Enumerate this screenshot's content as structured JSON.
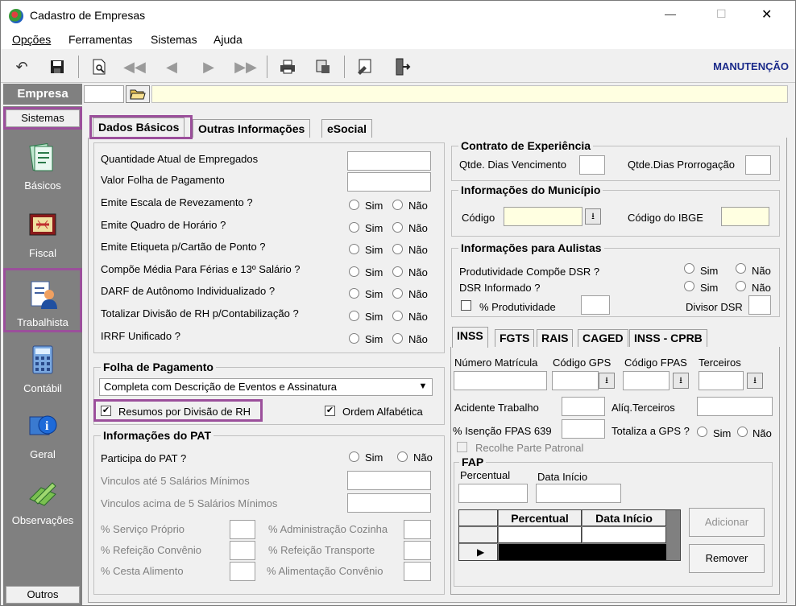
{
  "window": {
    "title": "Cadastro de Empresas",
    "minimize": "—",
    "maximize": "☐",
    "close": "✕"
  },
  "menu": [
    "Opções",
    "Ferramentas",
    "Sistemas",
    "Ajuda"
  ],
  "toolbar": {
    "mode": "MANUTENÇÃO"
  },
  "empresa": {
    "label": "Empresa",
    "value": ""
  },
  "nav": {
    "header": "Sistemas",
    "items": [
      "Básicos",
      "Fiscal",
      "Trabalhista",
      "Contábil",
      "Geral",
      "Observações"
    ],
    "footer": "Outros"
  },
  "tabs": [
    "Dados Básicos",
    "Outras Informações",
    "eSocial"
  ],
  "radio": {
    "sim": "Sim",
    "nao": "Não"
  },
  "basic": {
    "qtd_empregados": "Quantidade Atual de Empregados",
    "valor_folha": "Valor Folha de Pagamento",
    "questions": [
      "Emite Escala de Revezamento ?",
      "Emite Quadro de Horário ?",
      "Emite Etiqueta p/Cartão de Ponto ?",
      "Compõe Média Para Férias e 13º Salário ?",
      "DARF de Autônomo Individualizado ?",
      "Totalizar Divisão de RH p/Contabilização ?",
      "IRRF Unificado ?"
    ]
  },
  "folha": {
    "title": "Folha de Pagamento",
    "select": "Completa com Descrição de Eventos e Assinatura",
    "resumos": "Resumos por Divisão de RH",
    "ordem": "Ordem Alfabética"
  },
  "pat": {
    "title": "Informações do PAT",
    "participa": "Participa do PAT ?",
    "ate5": "Vinculos até 5 Salários Mínimos",
    "acima5": "Vinculos acima de 5 Salários Mínimos",
    "left": [
      "% Serviço Próprio",
      "% Refeição Convênio",
      "% Cesta Alimento"
    ],
    "right": [
      "% Administração Cozinha",
      "% Refeição Transporte",
      "% Alimentação Convênio"
    ]
  },
  "contrato": {
    "title": "Contrato de Experiência",
    "venc": "Qtde. Dias Vencimento",
    "prorr": "Qtde.Dias Prorrogação"
  },
  "municipio": {
    "title": "Informações do Município",
    "codigo": "Código",
    "ibge": "Código do IBGE"
  },
  "aulistas": {
    "title": "Informações para Aulistas",
    "prod": "Produtividade Compõe DSR ?",
    "dsr": "DSR Informado ?",
    "pct": "% Produtividade",
    "divisor": "Divisor DSR"
  },
  "inner_tabs": [
    "INSS",
    "FGTS",
    "RAIS",
    "CAGED",
    "INSS - CPRB"
  ],
  "inss": {
    "matricula": "Número Matrícula",
    "gps": "Código GPS",
    "fpas": "Código FPAS",
    "terceiros": "Terceiros",
    "acidente": "Acidente Trabalho",
    "aliq": "Alíq.Terceiros",
    "isencao": "% Isenção FPAS 639",
    "totaliza": "Totaliza a GPS ?",
    "recolhe": "Recolhe Parte Patronal"
  },
  "fap": {
    "title": "FAP",
    "percentual": "Percentual",
    "data": "Data Início",
    "cols": [
      "Percentual",
      "Data Início"
    ],
    "add": "Adicionar",
    "remove": "Remover"
  }
}
